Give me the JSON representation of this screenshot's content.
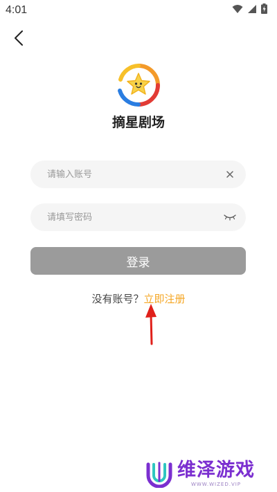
{
  "status_bar": {
    "time": "4:01",
    "icons": [
      "wifi-icon",
      "signal-icon",
      "battery-charging-icon"
    ]
  },
  "nav": {
    "back_icon": "chevron-left-icon"
  },
  "app": {
    "name": "摘星剧场",
    "logo": "star-logo-icon"
  },
  "login_form": {
    "username_placeholder": "请输入账号",
    "username_value": "",
    "clear_icon": "close-icon",
    "password_placeholder": "请填写密码",
    "password_value": "",
    "toggle_icon": "eye-closed-icon",
    "login_label": "登录"
  },
  "register": {
    "prompt": "没有账号？",
    "link": "立即注册"
  },
  "annotation": {
    "arrow_color": "#e0201a"
  },
  "watermark": {
    "title": "维泽游戏",
    "subtitle": "WWW.WIZED.VIP"
  },
  "colors": {
    "accent": "#f5a623",
    "button_disabled": "#9b9b9b",
    "field_bg": "#f5f5f5",
    "watermark": "#7b2fd0"
  }
}
